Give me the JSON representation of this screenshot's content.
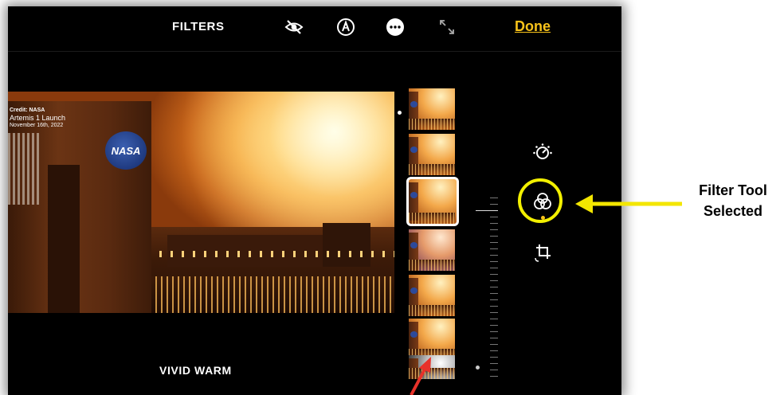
{
  "toolbar": {
    "title": "FILTERS",
    "done_label": "Done",
    "icons": [
      "hide-eye-icon",
      "markup-pen-icon",
      "more-ellipsis-icon",
      "aspect-arrows-icon"
    ]
  },
  "photo": {
    "credit_label": "Credit: NASA",
    "caption": "Artemis 1 Launch",
    "date": "November 16th, 2022",
    "logo_text": "NASA"
  },
  "filter": {
    "current_name": "VIVID WARM",
    "thumbnails": [
      "original",
      "vivid",
      "vivid-warm",
      "vivid-cool",
      "dramatic",
      "dramatic-warm",
      "mono"
    ],
    "selected_index": 2
  },
  "tools": [
    "adjust-dial-icon",
    "filters-circles-icon",
    "crop-rotate-icon"
  ],
  "annotation": {
    "label_line1": "Filter Tool",
    "label_line2": "Selected",
    "highlight_color": "#f3f000",
    "arrow_color": "#f3e600",
    "pointer_color": "#e8322a"
  },
  "colors": {
    "accent": "#f7c21a",
    "background": "#000000"
  }
}
